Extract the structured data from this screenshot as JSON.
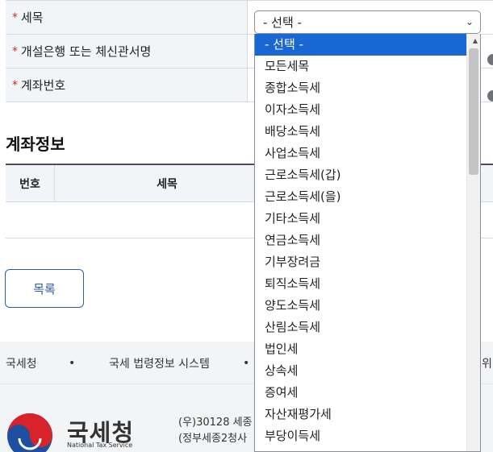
{
  "form": {
    "rows": [
      {
        "label": "세목",
        "required": "*"
      },
      {
        "label": "개설은행 또는 체신관서명",
        "required": "*"
      },
      {
        "label": "계좌번호",
        "required": "*"
      }
    ],
    "tax_select": {
      "value": "- 선택 -",
      "chevron": "⌄"
    }
  },
  "dropdown": {
    "options": [
      "- 선택 -",
      "모든세목",
      "종합소득세",
      "이자소득세",
      "배당소득세",
      "사업소득세",
      "근로소득세(갑)",
      "근로소득세(을)",
      "기타소득세",
      "연금소득세",
      "기부장려금",
      "퇴직소득세",
      "양도소득세",
      "산림소득세",
      "법인세",
      "상속세",
      "증여세",
      "자산재평가세",
      "부당이득세"
    ],
    "selected_index": 0
  },
  "account_section": {
    "title": "계좌정보",
    "columns": [
      "번호",
      "세목"
    ]
  },
  "buttons": {
    "list": "목록"
  },
  "footer": {
    "links": [
      "국세청",
      "국세 법령정보 시스템",
      "위"
    ],
    "separator": "•",
    "logo_text": "국세청",
    "logo_sub": "National Tax Service",
    "address_line1": "(우)30128 세종",
    "address_line2": "(정부세종2청사"
  },
  "colors": {
    "accent": "#1967d2",
    "button_border": "#2d5da8",
    "required": "#d62b2b"
  }
}
